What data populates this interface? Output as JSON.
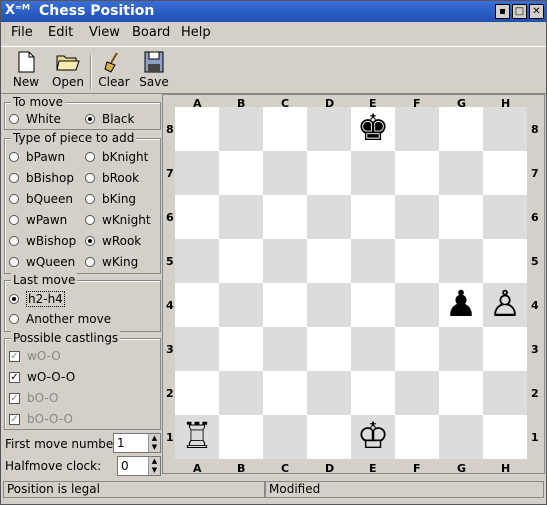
{
  "window": {
    "title": "Chess Position",
    "icon": "X-window-icon"
  },
  "menu": [
    "File",
    "Edit",
    "View",
    "Board",
    "Help"
  ],
  "toolbar": [
    {
      "label": "New",
      "icon": "new-file-icon"
    },
    {
      "label": "Open",
      "icon": "folder-open-icon"
    },
    {
      "label": "Clear",
      "icon": "broom-icon"
    },
    {
      "label": "Save",
      "icon": "floppy-disk-icon"
    }
  ],
  "to_move": {
    "label": "To move",
    "options": [
      "White",
      "Black"
    ],
    "selected": "Black"
  },
  "piece_type": {
    "label": "Type of piece to add",
    "options": [
      "bPawn",
      "bKnight",
      "bBishop",
      "bRook",
      "bQueen",
      "bKing",
      "wPawn",
      "wKnight",
      "wBishop",
      "wRook",
      "wQueen",
      "wKing"
    ],
    "selected": "wRook"
  },
  "last_move": {
    "label": "Last move",
    "options": [
      "h2-h4",
      "Another move"
    ],
    "selected": "h2-h4"
  },
  "castlings": {
    "label": "Possible castlings",
    "items": [
      {
        "label": "wO-O",
        "checked": true,
        "enabled": false
      },
      {
        "label": "wO-O-O",
        "checked": true,
        "enabled": true
      },
      {
        "label": "bO-O",
        "checked": true,
        "enabled": false
      },
      {
        "label": "bO-O-O",
        "checked": true,
        "enabled": false
      }
    ]
  },
  "first_move": {
    "label": "First move number:",
    "value": "1"
  },
  "halfmove": {
    "label": "Halfmove clock:",
    "value": "0"
  },
  "board": {
    "files": [
      "A",
      "B",
      "C",
      "D",
      "E",
      "F",
      "G",
      "H"
    ],
    "ranks": [
      "8",
      "7",
      "6",
      "5",
      "4",
      "3",
      "2",
      "1"
    ],
    "pieces": [
      {
        "square": "e8",
        "piece": "black-king",
        "glyph": "♚"
      },
      {
        "square": "g4",
        "piece": "black-pawn",
        "glyph": "♟"
      },
      {
        "square": "h4",
        "piece": "white-pawn",
        "glyph": "♙"
      },
      {
        "square": "a1",
        "piece": "white-rook",
        "glyph": "♖"
      },
      {
        "square": "e1",
        "piece": "white-king",
        "glyph": "♔"
      }
    ]
  },
  "status": {
    "left": "Position is legal",
    "right": "Modified"
  }
}
